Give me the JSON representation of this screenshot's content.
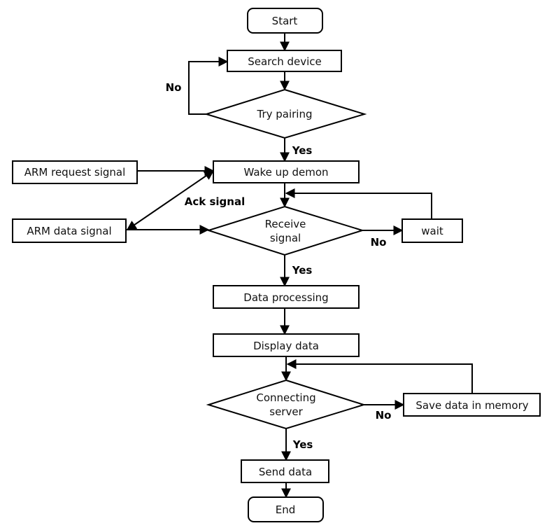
{
  "nodes": {
    "start": "Start",
    "search_device": "Search device",
    "try_pairing": "Try pairing",
    "wake_up_demon": "Wake up demon",
    "arm_request_signal": "ARM request signal",
    "arm_data_signal": "ARM data signal",
    "receive_signal_1": "Receive",
    "receive_signal_2": "signal",
    "wait": "wait",
    "data_processing": "Data processing",
    "display_data": "Display data",
    "connecting_server_1": "Connecting",
    "connecting_server_2": "server",
    "save_data": "Save data in memory",
    "send_data": "Send data",
    "end": "End"
  },
  "labels": {
    "pairing_no": "No",
    "pairing_yes": "Yes",
    "ack_signal": "Ack signal",
    "receive_no": "No",
    "receive_yes": "Yes",
    "server_no": "No",
    "server_yes": "Yes"
  }
}
